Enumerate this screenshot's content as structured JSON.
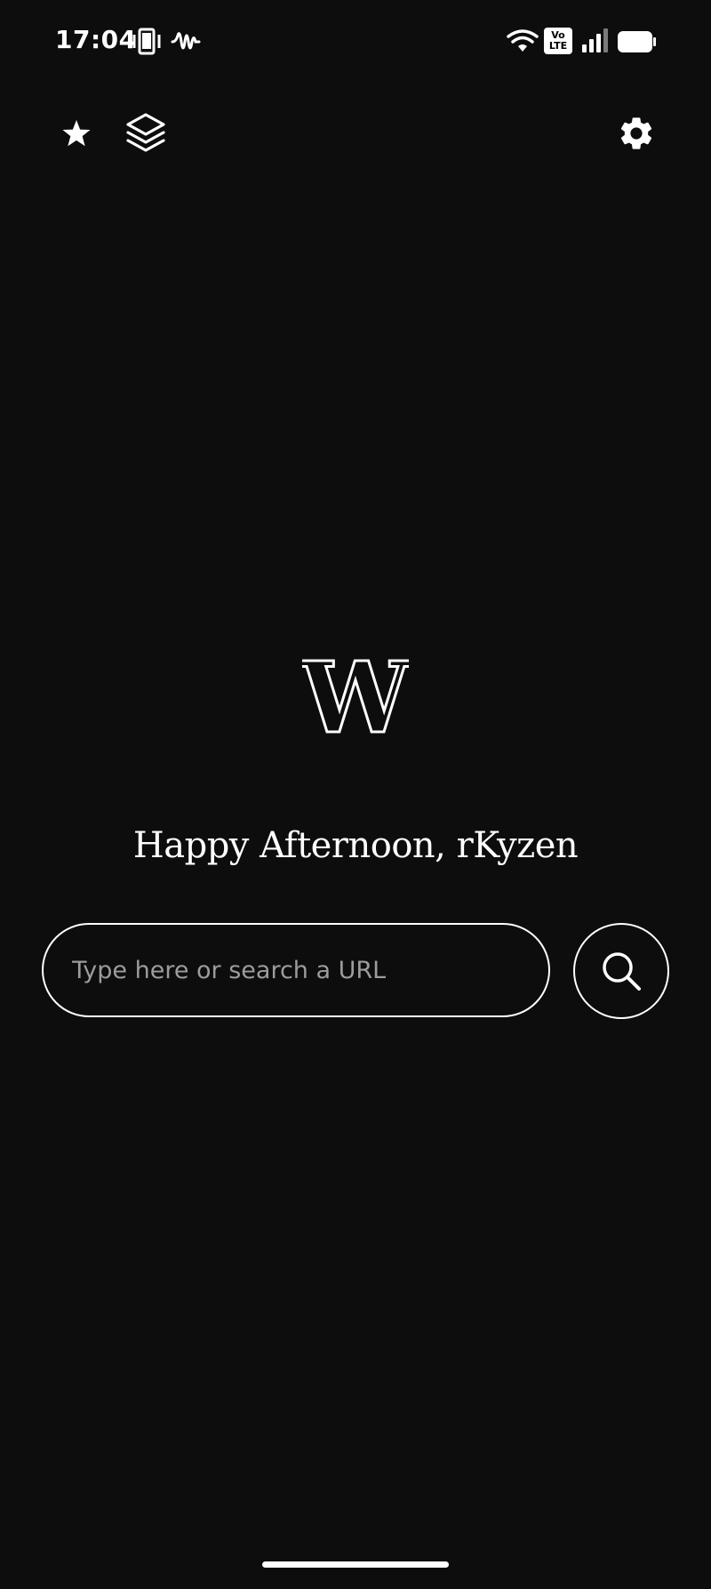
{
  "status_bar": {
    "time": "17:04",
    "left_icons": [
      "phone-vibrate-icon",
      "sound-wave-icon"
    ],
    "right_icons": [
      "wifi-icon",
      "volte-icon",
      "signal-icon",
      "battery-icon"
    ],
    "volte_top": "Vo",
    "volte_bottom": "LTE"
  },
  "toolbar": {
    "left_icons": [
      "star-icon",
      "layers-icon"
    ],
    "right_icons": [
      "gear-icon"
    ]
  },
  "main": {
    "logo_letter": "W",
    "greeting": "Happy Afternoon, rKyzen",
    "search": {
      "placeholder": "Type here or search a URL",
      "value": "",
      "button_icon": "search-icon"
    }
  },
  "colors": {
    "background": "#0d0d0d",
    "foreground": "#ffffff",
    "placeholder": "#9c9c9c"
  }
}
